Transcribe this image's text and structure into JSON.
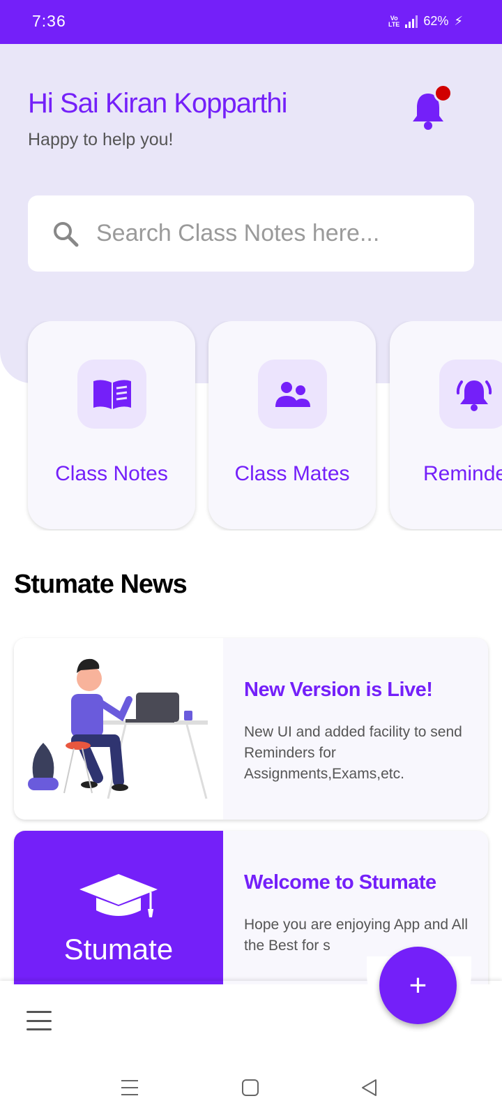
{
  "status_bar": {
    "time": "7:36",
    "network": "Vo LTE",
    "battery": "62%"
  },
  "header": {
    "greeting": "Hi Sai Kiran Kopparthi",
    "subtitle": "Happy to help you!",
    "notification_icon": "bell-icon",
    "has_unread": true
  },
  "search": {
    "placeholder": "Search Class Notes here..."
  },
  "categories": [
    {
      "label": "Class Notes",
      "icon": "book-icon"
    },
    {
      "label": "Class Mates",
      "icon": "users-icon"
    },
    {
      "label": "Reminde",
      "icon": "bell-ring-icon"
    }
  ],
  "news": {
    "title": "Stumate News",
    "items": [
      {
        "headline": "New Version is Live!",
        "body": "New UI and added facility to send Reminders for Assignments,Exams,etc."
      },
      {
        "headline": "Welcome to Stumate",
        "body": "Hope you are enjoying App and All the Best for s",
        "brand": "Stumate"
      }
    ]
  },
  "bottom_nav": {
    "menu_icon": "hamburger-icon",
    "fab_label": "+"
  },
  "colors": {
    "accent": "#7420f9",
    "header_bg": "#e9e6f8",
    "card_bg": "#f8f7fd",
    "badge": "#d10000"
  }
}
